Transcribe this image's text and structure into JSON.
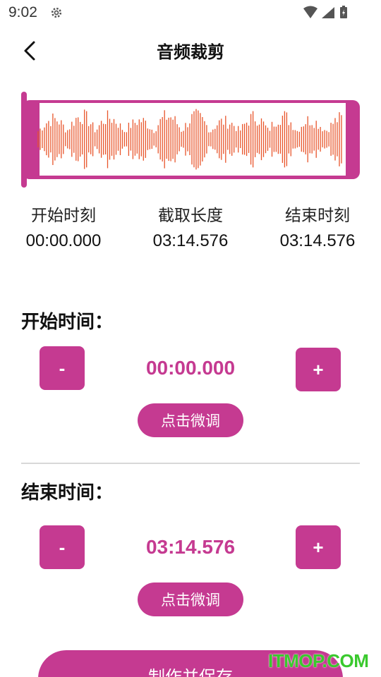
{
  "status_bar": {
    "time": "9:02"
  },
  "header": {
    "title": "音频裁剪"
  },
  "colors": {
    "accent": "#c53a91",
    "wave": "#e8552b",
    "watermark": "#3ac92e"
  },
  "info": {
    "start_label": "开始时刻",
    "start_value": "00:00.000",
    "duration_label": "截取长度",
    "duration_value": "03:14.576",
    "end_label": "结束时刻",
    "end_value": "03:14.576"
  },
  "start_section": {
    "title": "开始时间：",
    "minus_label": "-",
    "plus_label": "+",
    "value": "00:00.000",
    "fine_tune_label": "点击微调"
  },
  "end_section": {
    "title": "结束时间：",
    "minus_label": "-",
    "plus_label": "+",
    "value": "03:14.576",
    "fine_tune_label": "点击微调"
  },
  "save_button": {
    "label": "制作并保存"
  },
  "watermark": {
    "text": "ITMOP.COM"
  }
}
